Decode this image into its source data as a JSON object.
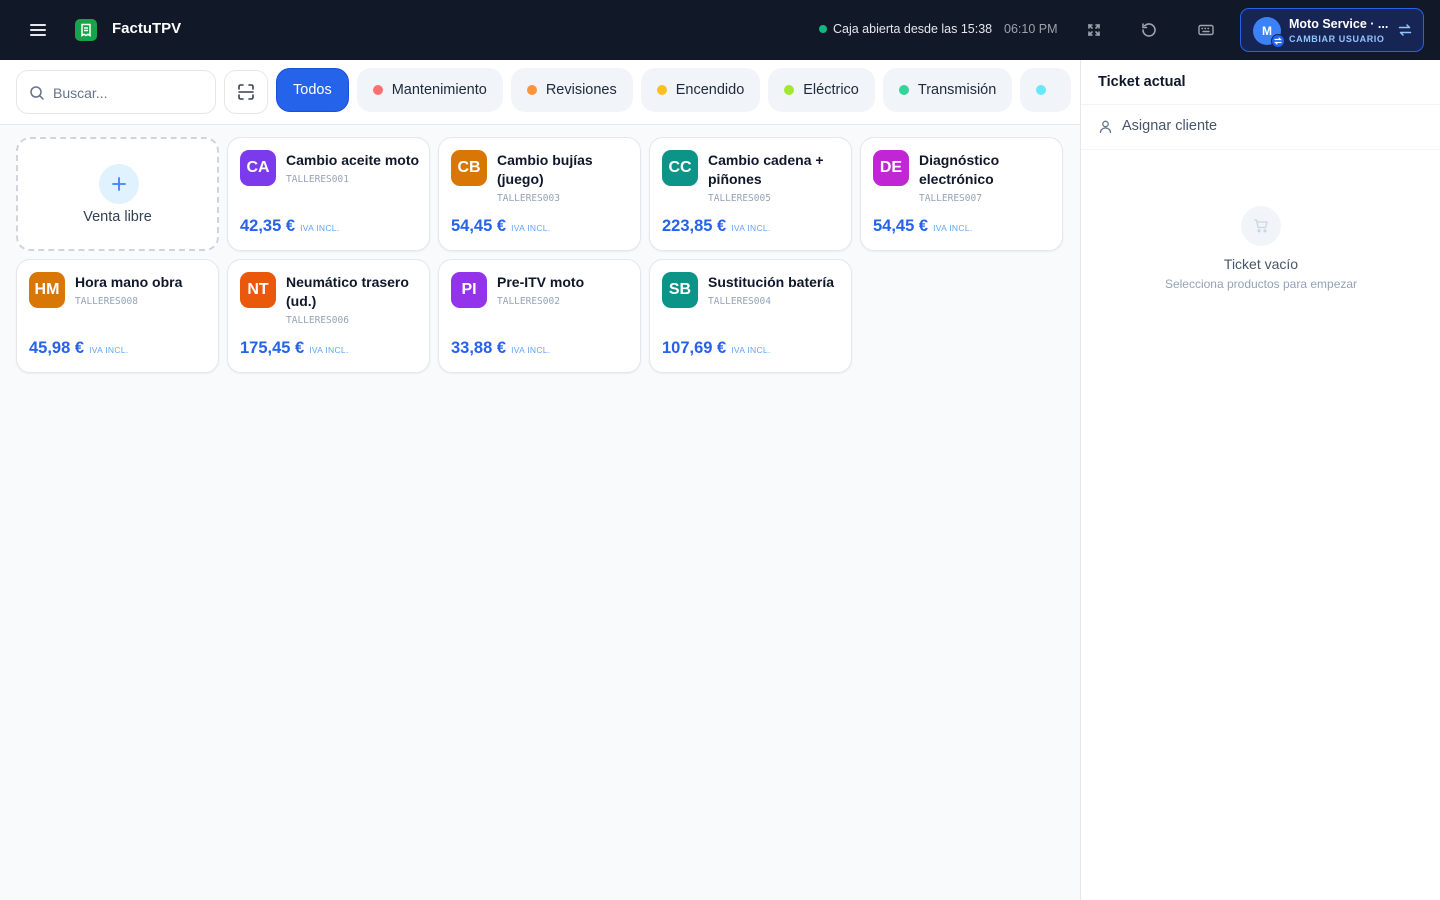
{
  "app": {
    "title": "FactuTPV"
  },
  "status": {
    "text": "Caja abierta desde las 15:38",
    "time": "06:10 PM",
    "color": "#10b981"
  },
  "user": {
    "initial": "M",
    "name": "Moto Service · ...",
    "action": "CAMBIAR USUARIO"
  },
  "search": {
    "placeholder": "Buscar..."
  },
  "categories": [
    {
      "label": "Todos",
      "active": true
    },
    {
      "label": "Mantenimiento",
      "color": "#f87171"
    },
    {
      "label": "Revisiones",
      "color": "#fb923c"
    },
    {
      "label": "Encendido",
      "color": "#fbbf24"
    },
    {
      "label": "Eléctrico",
      "color": "#a3e635"
    },
    {
      "label": "Transmisión",
      "color": "#34d399"
    },
    {
      "label": "",
      "color": "#67e8f9"
    }
  ],
  "free_sale": {
    "label": "Venta libre"
  },
  "products": [
    {
      "initials": "CA",
      "name": "Cambio aceite moto",
      "ref": "TALLERES001",
      "price": "42,35 €",
      "iva": "IVA INCL.",
      "color": "#7c3aed"
    },
    {
      "initials": "CB",
      "name": "Cambio bujías (juego)",
      "ref": "TALLERES003",
      "price": "54,45 €",
      "iva": "IVA INCL.",
      "color": "#d97706"
    },
    {
      "initials": "CC",
      "name": "Cambio cadena + piñones",
      "ref": "TALLERES005",
      "price": "223,85 €",
      "iva": "IVA INCL.",
      "color": "#0d9488"
    },
    {
      "initials": "DE",
      "name": "Diagnóstico electrónico",
      "ref": "TALLERES007",
      "price": "54,45 €",
      "iva": "IVA INCL.",
      "color": "#c026d3"
    },
    {
      "initials": "HM",
      "name": "Hora mano obra",
      "ref": "TALLERES008",
      "price": "45,98 €",
      "iva": "IVA INCL.",
      "color": "#d97706"
    },
    {
      "initials": "NT",
      "name": "Neumático trasero (ud.)",
      "ref": "TALLERES006",
      "price": "175,45 €",
      "iva": "IVA INCL.",
      "color": "#ea580c"
    },
    {
      "initials": "PI",
      "name": "Pre-ITV moto",
      "ref": "TALLERES002",
      "price": "33,88 €",
      "iva": "IVA INCL.",
      "color": "#9333ea"
    },
    {
      "initials": "SB",
      "name": "Sustitución batería",
      "ref": "TALLERES004",
      "price": "107,69 €",
      "iva": "IVA INCL.",
      "color": "#0d9488"
    }
  ],
  "ticket": {
    "title": "Ticket actual",
    "assign_label": "Asignar cliente",
    "empty_title": "Ticket vacío",
    "empty_subtitle": "Selecciona productos para empezar"
  },
  "icons": {
    "menu": "menu-icon",
    "logo": "receipt-logo-icon",
    "fullscreen": "fullscreen-icon",
    "refresh": "refresh-icon",
    "keyboard": "keyboard-icon",
    "swap": "swap-icon",
    "search": "search-icon",
    "scan": "scan-icon",
    "plus": "plus-icon",
    "user": "user-icon",
    "cart": "cart-icon"
  }
}
